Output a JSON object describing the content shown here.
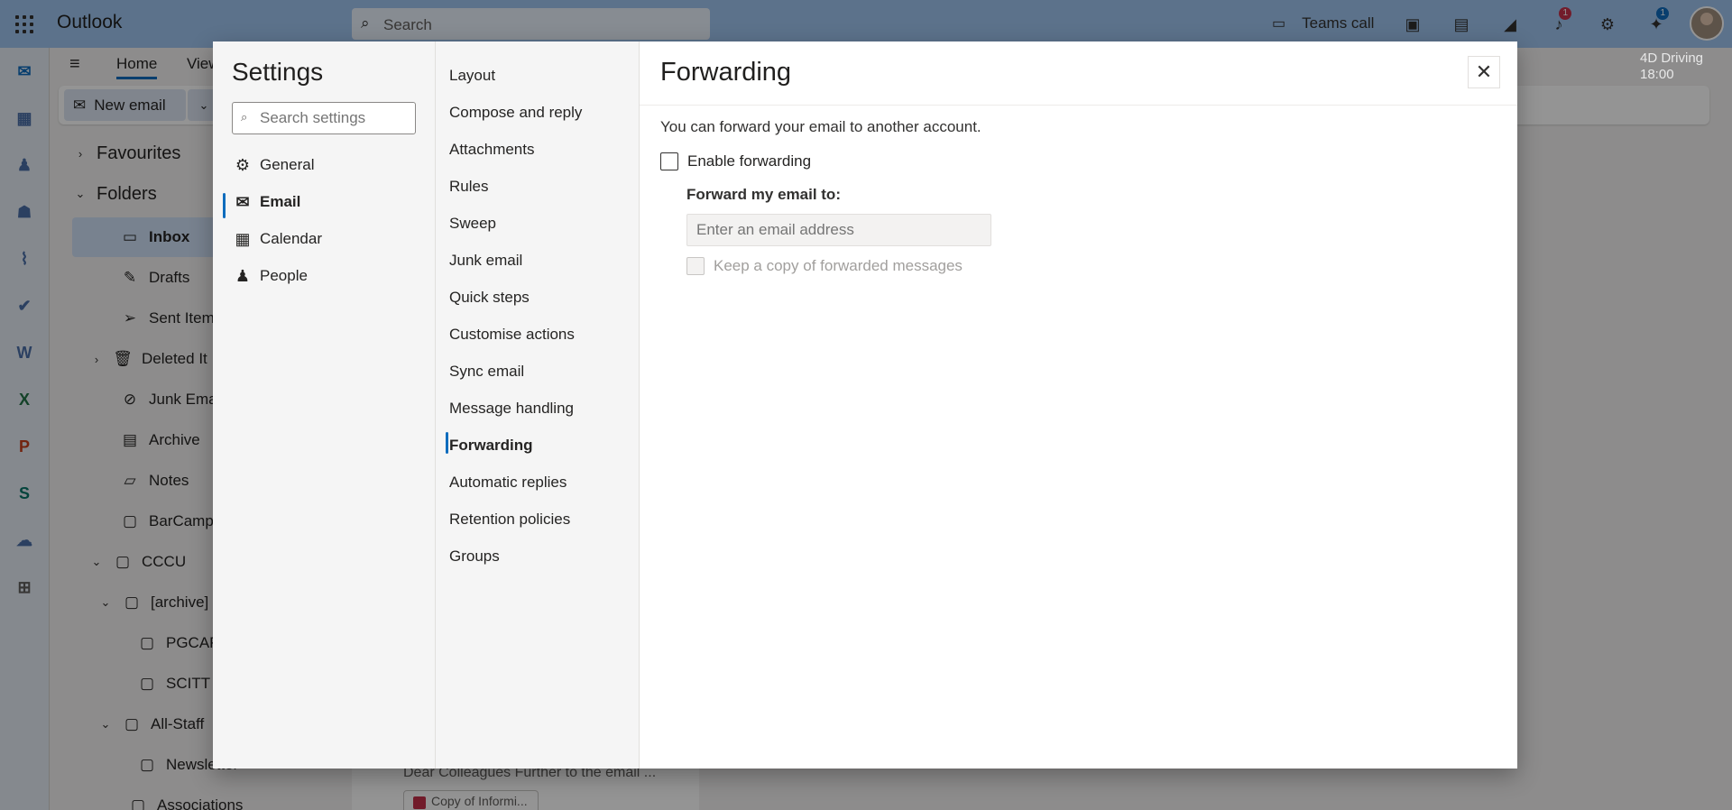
{
  "app": {
    "title": "Outlook"
  },
  "search": {
    "placeholder": "Search"
  },
  "top_right": {
    "teams_call": "Teams call",
    "notification_count": "1",
    "update_count": "1",
    "reminder_title": "4D Driving",
    "reminder_time": "18:00"
  },
  "ribbon": {
    "tabs": [
      "Home",
      "View"
    ],
    "new_email": "New email"
  },
  "folders": {
    "favourites": "Favourites",
    "folders": "Folders",
    "items": [
      {
        "label": "Inbox",
        "icon": "inbox-icon"
      },
      {
        "label": "Drafts",
        "icon": "pencil-icon"
      },
      {
        "label": "Sent Items",
        "icon": "send-icon"
      },
      {
        "label": "Deleted It",
        "icon": "trash-icon"
      },
      {
        "label": "Junk Email",
        "icon": "junk-icon"
      },
      {
        "label": "Archive",
        "icon": "archive-icon"
      },
      {
        "label": "Notes",
        "icon": "note-icon"
      },
      {
        "label": "BarCamp",
        "icon": "folder-icon"
      },
      {
        "label": "CCCU",
        "icon": "folder-icon"
      },
      {
        "label": "[archive]",
        "icon": "folder-icon"
      },
      {
        "label": "PGCAP",
        "icon": "folder-icon"
      },
      {
        "label": "SCITT",
        "icon": "folder-icon"
      },
      {
        "label": "All-Staff",
        "icon": "folder-icon"
      },
      {
        "label": "Newsletter",
        "icon": "folder-icon"
      },
      {
        "label": "Associations",
        "icon": "folder-icon"
      }
    ]
  },
  "mail_list": {
    "preview": "Dear Colleagues Further to the email ...",
    "attachment": "Copy of Informi..."
  },
  "settings": {
    "title": "Settings",
    "search_placeholder": "Search settings",
    "categories": [
      {
        "label": "General",
        "icon": "gear-icon"
      },
      {
        "label": "Email",
        "icon": "mail-icon"
      },
      {
        "label": "Calendar",
        "icon": "calendar-icon"
      },
      {
        "label": "People",
        "icon": "people-icon"
      }
    ],
    "selected_category": "Email",
    "subcategories": [
      "Layout",
      "Compose and reply",
      "Attachments",
      "Rules",
      "Sweep",
      "Junk email",
      "Quick steps",
      "Customise actions",
      "Sync email",
      "Message handling",
      "Forwarding",
      "Automatic replies",
      "Retention policies",
      "Groups"
    ],
    "selected_subcategory": "Forwarding"
  },
  "forwarding": {
    "title": "Forwarding",
    "description": "You can forward your email to another account.",
    "enable_label": "Enable forwarding",
    "enabled": false,
    "forward_to_label": "Forward my email to:",
    "email_placeholder": "Enter an email address",
    "keep_copy_label": "Keep a copy of forwarded messages",
    "keep_copy": false
  },
  "colors": {
    "accent": "#0f6cbd",
    "topbar": "#9fc4ef"
  }
}
